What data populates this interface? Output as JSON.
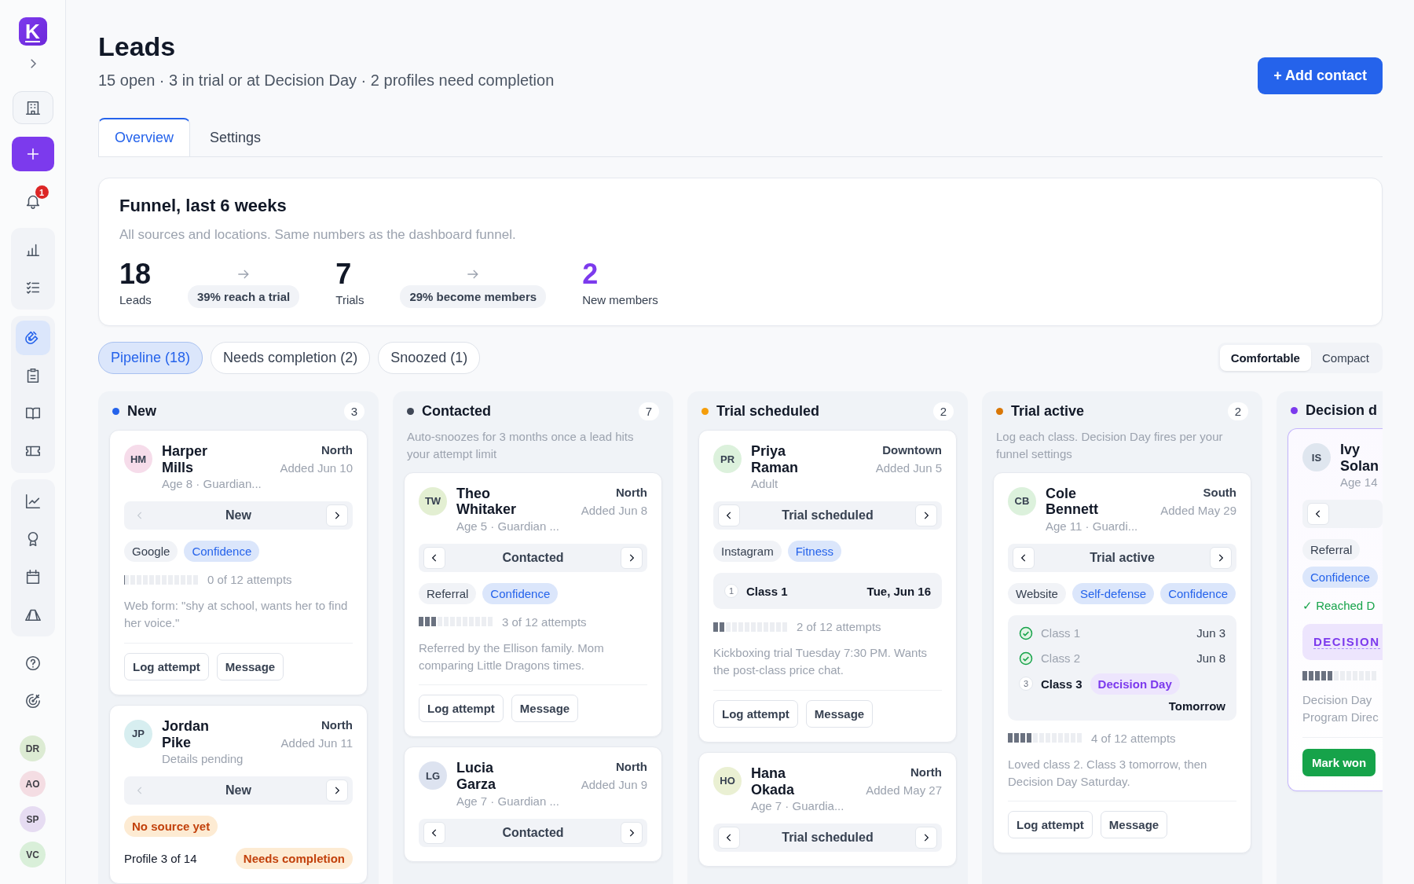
{
  "sidebar": {
    "logo": "K",
    "groups": [
      {
        "items": [
          {
            "selected": false
          }
        ]
      },
      {
        "items": [
          {
            "selected": false
          }
        ]
      },
      {
        "items": [
          {
            "selected": false,
            "badge": "1"
          }
        ]
      },
      {
        "items": [
          {
            "selected": false
          },
          {
            "selected": false
          }
        ]
      },
      {
        "items": [
          {
            "selected": true
          },
          {
            "selected": false
          },
          {
            "selected": false
          },
          {
            "selected": false
          }
        ]
      },
      {
        "items": [
          {
            "selected": false
          },
          {
            "selected": false
          },
          {
            "selected": false
          },
          {
            "selected": false
          }
        ]
      },
      {
        "items": [
          {
            "selected": false
          },
          {
            "selected": false
          }
        ]
      }
    ],
    "avatars": [
      {
        "initials": "DR",
        "color": "#dcebd3"
      },
      {
        "initials": "AO",
        "color": "#f4dde3"
      },
      {
        "initials": "SP",
        "color": "#e6dcf2"
      },
      {
        "initials": "VC",
        "color": "#d9efd9"
      }
    ]
  },
  "header": {
    "title": "Leads",
    "subtitle": "15 open · 3 in trial or at Decision Day · 2 profiles need completion",
    "action": "+ Add contact"
  },
  "tabs": [
    {
      "label": "Overview",
      "selected": true
    },
    {
      "label": "Settings",
      "selected": false
    }
  ],
  "funnel": {
    "title": "Funnel, last 6 weeks",
    "subtitle": "All sources and locations. Same numbers as the dashboard funnel.",
    "steps": [
      {
        "kind": "stat",
        "value": "18",
        "label": "Leads"
      },
      {
        "kind": "rate",
        "label": "39% reach a trial"
      },
      {
        "kind": "stat",
        "value": "7",
        "label": "Trials"
      },
      {
        "kind": "rate",
        "label": "29% become members"
      },
      {
        "kind": "goal",
        "value": "2",
        "label": "New members"
      }
    ]
  },
  "filters": [
    {
      "label": "Pipeline (18)",
      "selected": true
    },
    {
      "label": "Needs completion (2)",
      "selected": false
    },
    {
      "label": "Snoozed (1)",
      "selected": false
    }
  ],
  "density": [
    {
      "label": "Comfortable",
      "selected": true
    },
    {
      "label": "Compact",
      "selected": false
    }
  ],
  "columns": [
    {
      "title": "New",
      "color": "#2563eb",
      "count": "3",
      "cards": [
        {
          "initials": "HM",
          "color": "#f6dcea",
          "name": "Harper Mills",
          "region": "North",
          "added": "Added Jun 10",
          "detail": "Age 8 · Guardian...",
          "stage": "New",
          "prev_disabled": true,
          "tags": [
            {
              "label": "Google",
              "kind": "source"
            },
            {
              "label": "Confidence",
              "kind": "topic"
            }
          ],
          "level": 0,
          "attempts": "0 of 12 attempts",
          "note": "Web form: \"shy at school, wants her to find her voice.\"",
          "actions": [
            "Log attempt",
            "Message"
          ],
          "highlight": false
        },
        {
          "initials": "JP",
          "color": "#d7eef0",
          "name": "Jordan Pike",
          "region": "North",
          "added": "Added Jun 11",
          "detail": "Details pending",
          "stage": "New",
          "prev_disabled": true,
          "tags": [
            {
              "label": "No source yet",
              "kind": "warn"
            }
          ],
          "profile": {
            "text": "Profile 3 of 14",
            "tag": "Needs completion"
          },
          "highlight": false
        }
      ]
    },
    {
      "title": "Contacted",
      "color": "#3f4756",
      "count": "7",
      "description": "Auto-snoozes for 3 months once a lead hits your attempt limit",
      "cards": [
        {
          "initials": "TW",
          "color": "#e3efd2",
          "name": "Theo Whitaker",
          "region": "North",
          "added": "Added Jun 8",
          "detail": "Age 5 · Guardian ...",
          "stage": "Contacted",
          "prev_disabled": false,
          "tags": [
            {
              "label": "Referral",
              "kind": "source"
            },
            {
              "label": "Confidence",
              "kind": "topic"
            }
          ],
          "level": 0.25,
          "attempts": "3 of 12 attempts",
          "note": "Referred by the Ellison family. Mom comparing Little Dragons times.",
          "actions": [
            "Log attempt",
            "Message"
          ],
          "highlight": false
        },
        {
          "initials": "LG",
          "color": "#dde3f0",
          "name": "Lucia Garza",
          "region": "North",
          "added": "Added Jun 9",
          "detail": "Age 7 · Guardian ...",
          "stage": "Contacted",
          "prev_disabled": false,
          "highlight": false
        }
      ]
    },
    {
      "title": "Trial scheduled",
      "color": "#f59e0b",
      "count": "2",
      "cards": [
        {
          "initials": "PR",
          "color": "#dcf1dc",
          "name": "Priya Raman",
          "region": "Downtown",
          "added": "Added Jun 5",
          "detail": "Adult",
          "stage": "Trial scheduled",
          "prev_disabled": false,
          "tags": [
            {
              "label": "Instagram",
              "kind": "source"
            },
            {
              "label": "Fitness",
              "kind": "topic"
            }
          ],
          "classes": {
            "rows": [
              {
                "done": false,
                "num": "1",
                "label": "Class 1",
                "date": "Tue, Jun 16"
              }
            ]
          },
          "level": 0.1667,
          "attempts": "2 of 12 attempts",
          "note": "Kickboxing trial Tuesday 7:30 PM. Wants the post-class price chat.",
          "actions": [
            "Log attempt",
            "Message"
          ],
          "highlight": false
        },
        {
          "initials": "HO",
          "color": "#eaf0d3",
          "name": "Hana Okada",
          "region": "North",
          "added": "Added May 27",
          "detail": "Age 7 · Guardia...",
          "stage": "Trial scheduled",
          "prev_disabled": false,
          "highlight": false
        }
      ]
    },
    {
      "title": "Trial active",
      "color": "#d97706",
      "count": "2",
      "description": "Log each class. Decision Day fires per your funnel settings",
      "cards": [
        {
          "initials": "CB",
          "color": "#dcf1dc",
          "name": "Cole Bennett",
          "region": "South",
          "added": "Added May 29",
          "detail": "Age 11 · Guardi...",
          "stage": "Trial active",
          "prev_disabled": false,
          "tags": [
            {
              "label": "Website",
              "kind": "source"
            },
            {
              "label": "Self-defense",
              "kind": "topic"
            },
            {
              "label": "Confidence",
              "kind": "topic"
            }
          ],
          "classes": {
            "rows": [
              {
                "done": true,
                "label": "Class 1",
                "date": "Jun 3"
              },
              {
                "done": true,
                "label": "Class 2",
                "date": "Jun 8"
              },
              {
                "done": false,
                "num": "3",
                "label": "Class 3",
                "tag": "Decision Day"
              }
            ],
            "footer": "Tomorrow"
          },
          "level": 0.3333,
          "attempts": "4 of 12 attempts",
          "note": "Loved class 2. Class 3 tomorrow, then Decision Day Saturday.",
          "actions": [
            "Log attempt",
            "Message"
          ],
          "highlight": false
        }
      ]
    },
    {
      "title": "Decision d",
      "color": "#7c3aed",
      "cards": [
        {
          "initials": "IS",
          "color": "#dfe6ef",
          "name": "Ivy Solan",
          "detail": "Age 14",
          "prev_disabled": false,
          "tags": [
            {
              "label": "Referral",
              "kind": "source"
            },
            {
              "label": "Confidence",
              "kind": "topic"
            }
          ],
          "reached": "✓ Reached D",
          "banner": "DECISION",
          "level": 0.4167,
          "note": "Decision Day\nProgram Direc",
          "primary": "Mark won",
          "highlight": true
        }
      ]
    }
  ]
}
